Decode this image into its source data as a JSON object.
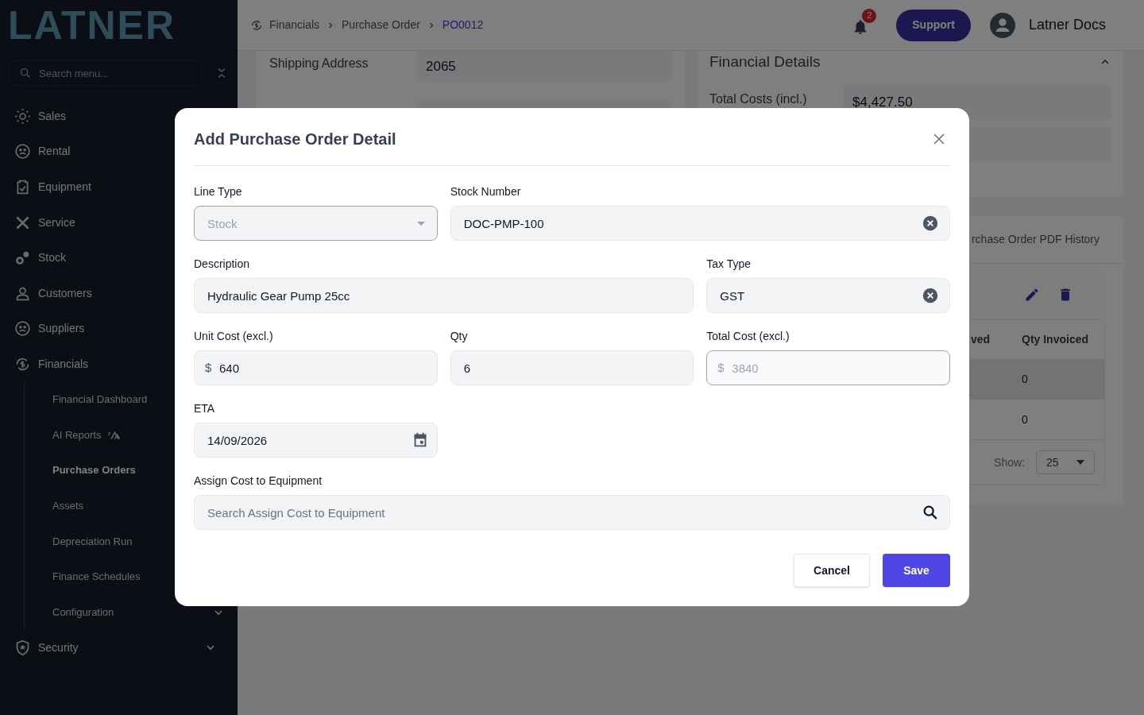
{
  "sidebar": {
    "logo": "LATNER",
    "search": {
      "placeholder": "Search menu..."
    },
    "items": [
      {
        "label": "Sales",
        "selected": false
      },
      {
        "label": "Rental",
        "selected": false
      },
      {
        "label": "Equipment",
        "selected": false
      },
      {
        "label": "Service",
        "selected": false
      },
      {
        "label": "Stock",
        "selected": false
      },
      {
        "label": "Customers",
        "selected": false
      },
      {
        "label": "Suppliers",
        "selected": false
      },
      {
        "label": "Financials",
        "selected": false,
        "expanded": true,
        "children": [
          {
            "label": "Financial Dashboard",
            "selected": false
          },
          {
            "label": "AI Reports",
            "selected": false,
            "badge_icon": true
          },
          {
            "label": "Purchase Orders",
            "selected": true
          },
          {
            "label": "Assets",
            "selected": false
          },
          {
            "label": "Depreciation Run",
            "selected": false
          },
          {
            "label": "Finance Schedules",
            "selected": false
          },
          {
            "label": "Configuration",
            "selected": false,
            "expanded": false
          }
        ]
      },
      {
        "label": "Security",
        "selected": false,
        "expanded": false
      }
    ]
  },
  "header": {
    "breadcrumb": [
      {
        "label": "Financials",
        "current": false
      },
      {
        "label": "Purchase Order",
        "current": false
      },
      {
        "label": "PO0012",
        "current": true
      }
    ],
    "notification_count": "2",
    "support_button": "Support",
    "user_name": "Latner Docs"
  },
  "background": {
    "left_card": {
      "rows": [
        {
          "label": "Shipping Address",
          "value": "2065"
        }
      ]
    },
    "financial_card": {
      "title": "Financial Details",
      "expanded": true,
      "rows": [
        {
          "label": "Total Costs (incl.)",
          "value": "$4,427.50"
        }
      ]
    },
    "lines_card": {
      "tab": "rchase Order PDF History",
      "columns": [
        "ved",
        "Qty Invoiced"
      ],
      "rows": [
        {
          "selected": true,
          "cells": [
            "0"
          ]
        },
        {
          "selected": false,
          "cells": [
            "0"
          ]
        }
      ],
      "show_label": "Show:",
      "page_size": "25"
    }
  },
  "modal": {
    "title": "Add Purchase Order Detail",
    "fields": [
      {
        "kind": "select",
        "label": "Line Type",
        "value": "Stock",
        "disabled": true
      },
      {
        "kind": "clearable",
        "label": "Stock Number",
        "value": "DOC-PMP-100",
        "disabled": false
      },
      {
        "kind": "text",
        "label": "Description",
        "value": "Hydraulic Gear Pump 25cc",
        "disabled": false
      },
      {
        "kind": "clearable",
        "label": "Tax Type",
        "value": "GST",
        "disabled": false
      },
      {
        "kind": "currency",
        "label": "Unit Cost (excl.)",
        "prefix": "$",
        "value": "640",
        "disabled": false
      },
      {
        "kind": "text",
        "label": "Qty",
        "value": "6",
        "disabled": false
      },
      {
        "kind": "currency",
        "label": "Total Cost (excl.)",
        "prefix": "$",
        "value": "3840",
        "disabled": true
      },
      {
        "kind": "date",
        "label": "ETA",
        "value": "14/09/2026",
        "disabled": false
      },
      {
        "kind": "search",
        "label": "Assign Cost to Equipment",
        "placeholder": "Search Assign Cost to Equipment",
        "disabled": false
      }
    ],
    "buttons": [
      {
        "label": "Cancel",
        "primary": false
      },
      {
        "label": "Save",
        "primary": true
      }
    ]
  }
}
